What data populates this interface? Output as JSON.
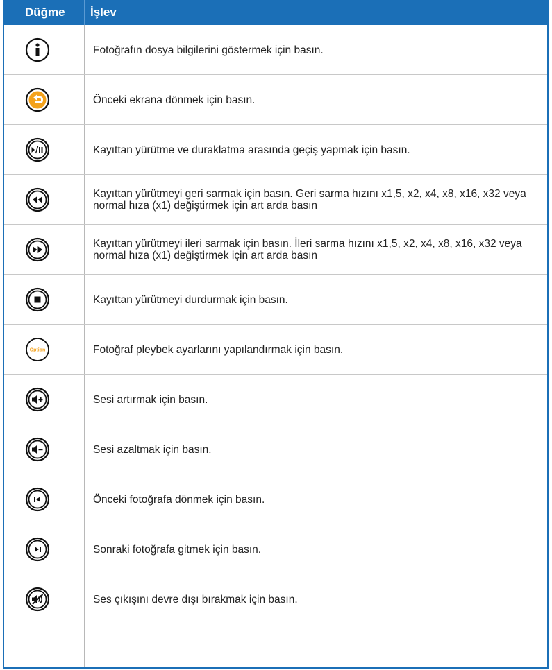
{
  "header": {
    "col1": "Düğme",
    "col2": "İşlev"
  },
  "rows": [
    {
      "icon": "info-icon",
      "text": "Fotoğrafın dosya bilgilerini göstermek için basın."
    },
    {
      "icon": "back-icon",
      "text": "Önceki ekrana dönmek için basın."
    },
    {
      "icon": "play-pause-icon",
      "text": "Kayıttan yürütme ve duraklatma arasında geçiş yapmak için basın."
    },
    {
      "icon": "rewind-icon",
      "text": "Kayıttan yürütmeyi geri sarmak için basın. Geri sarma hızını x1,5, x2, x4, x8, x16, x32 veya normal hıza (x1) değiştirmek için art arda basın"
    },
    {
      "icon": "fast-forward-icon",
      "text": "Kayıttan yürütmeyi ileri sarmak için basın. İleri sarma hızını x1,5, x2, x4, x8, x16, x32 veya normal hıza (x1) değiştirmek için art arda basın"
    },
    {
      "icon": "stop-icon",
      "text": "Kayıttan yürütmeyi durdurmak için basın."
    },
    {
      "icon": "option-icon",
      "label": "Option",
      "text": "Fotoğraf pleybek ayarlarını yapılandırmak için basın."
    },
    {
      "icon": "volume-up-icon",
      "text": "Sesi artırmak için basın."
    },
    {
      "icon": "volume-down-icon",
      "text": "Sesi azaltmak için basın."
    },
    {
      "icon": "previous-icon",
      "text": "Önceki fotoğrafa dönmek için basın."
    },
    {
      "icon": "next-icon",
      "text": "Sonraki fotoğrafa gitmek için basın."
    },
    {
      "icon": "mute-icon",
      "text": "Ses çıkışını devre dışı bırakmak için basın."
    }
  ],
  "colors": {
    "header": "#1b6fb7",
    "option": "#f4a21c"
  }
}
